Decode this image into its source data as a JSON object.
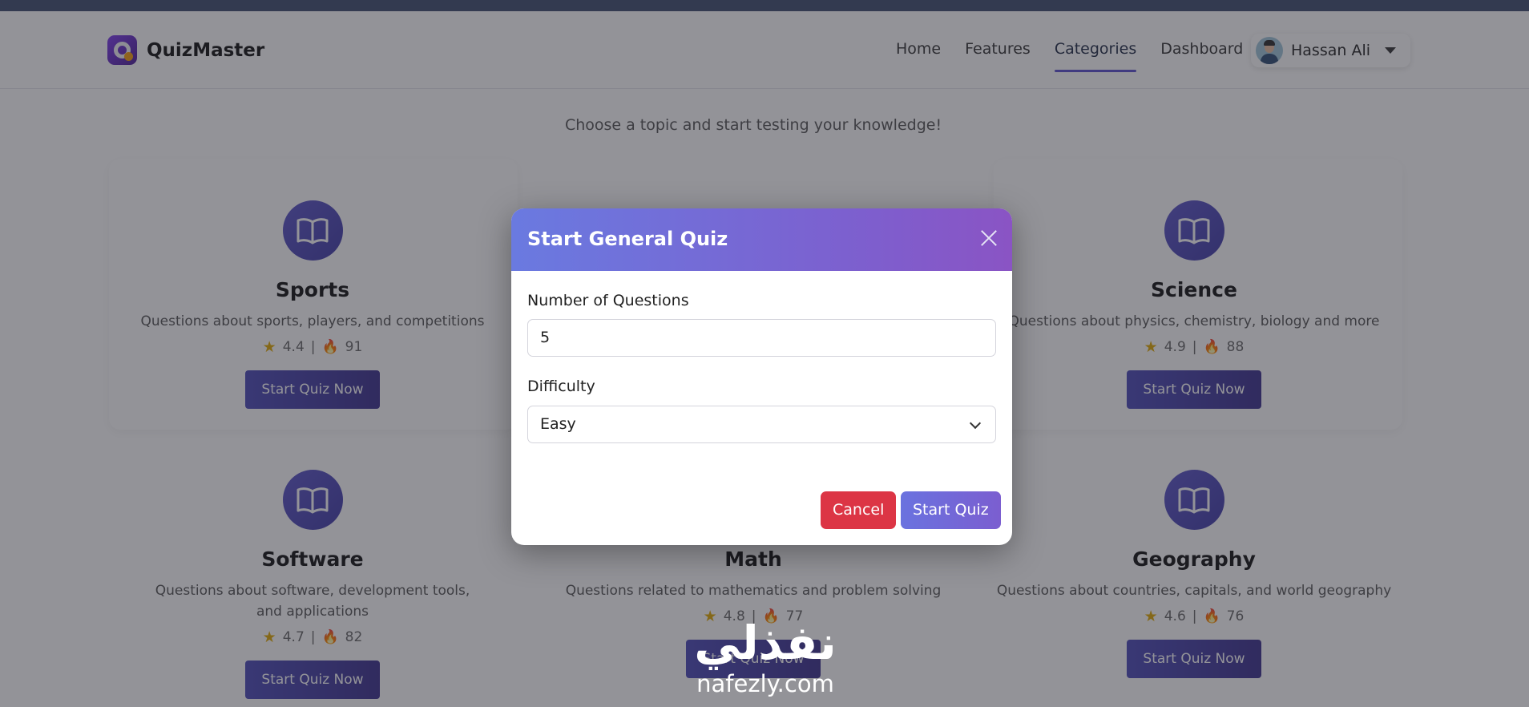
{
  "navbar": {
    "brand_name": "QuizMaster",
    "links": [
      {
        "label": "Home",
        "active": false
      },
      {
        "label": "Features",
        "active": false
      },
      {
        "label": "Categories",
        "active": true
      },
      {
        "label": "Dashboard",
        "active": false
      }
    ],
    "user_name": "Hassan Ali"
  },
  "page": {
    "subtitle": "Choose a topic and start testing your knowledge!"
  },
  "categories": [
    {
      "title": "Sports",
      "description": "Questions about sports, players, and competitions",
      "rating": "4.4",
      "plays": "91",
      "button": "Start Quiz Now"
    },
    {
      "title": "Science",
      "description": "Questions about physics, chemistry, biology and more",
      "rating": "4.9",
      "plays": "88",
      "button": "Start Quiz Now"
    },
    {
      "title": "Software",
      "description": "Questions about software, development tools, and applications",
      "rating": "4.7",
      "plays": "82",
      "button": "Start Quiz Now"
    },
    {
      "title": "Math",
      "description": "Questions related to mathematics and problem solving",
      "rating": "4.8",
      "plays": "77",
      "button": "Start Quiz Now"
    },
    {
      "title": "Geography",
      "description": "Questions about countries, capitals, and world geography",
      "rating": "4.6",
      "plays": "76",
      "button": "Start Quiz Now"
    }
  ],
  "stats_separator": "|",
  "modal": {
    "title": "Start General Quiz",
    "questions_label": "Number of Questions",
    "questions_value": "5",
    "difficulty_label": "Difficulty",
    "difficulty_value": "Easy",
    "cancel_label": "Cancel",
    "start_label": "Start Quiz"
  },
  "watermark": {
    "arabic": "نفذلي",
    "latin": "nafezly.com"
  },
  "colors": {
    "accent": "#5b4fcf",
    "cancel": "#dc3545",
    "button": "#4b49b8"
  }
}
